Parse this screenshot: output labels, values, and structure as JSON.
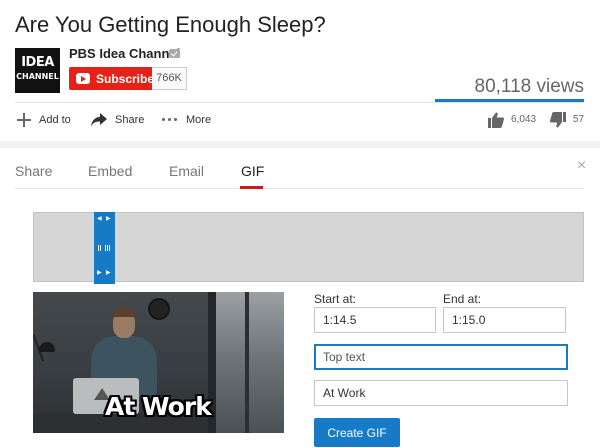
{
  "video": {
    "title": "Are You Getting Enough Sleep?",
    "views": "80,118 views"
  },
  "channel": {
    "logo_line1": "IDEA",
    "logo_line2": "CHANNEL",
    "name": "PBS Idea Channel",
    "subscribe_label": "Subscribe",
    "subscriber_count": "766K"
  },
  "actions": {
    "add_to": "Add to",
    "share": "Share",
    "more": "More",
    "likes": "6,043",
    "dislikes": "57"
  },
  "share_panel": {
    "tabs": [
      {
        "label": "Share"
      },
      {
        "label": "Embed"
      },
      {
        "label": "Email"
      },
      {
        "label": "GIF",
        "active": true
      }
    ],
    "close_symbol": "×"
  },
  "gif": {
    "caption": "At Work",
    "start_label": "Start at:",
    "start_value": "1:14.5",
    "end_label": "End at:",
    "end_value": "1:15.0",
    "top_text_placeholder": "Top text",
    "top_text_value": "",
    "bottom_text_value": "At Work",
    "create_label": "Create GIF"
  },
  "colors": {
    "accent": "#167ac6",
    "subscribe_red": "#e62117",
    "active_tab_underline": "#cc181e"
  },
  "icons": {
    "add": "plus-icon",
    "share": "share-arrow-icon",
    "more": "ellipsis-icon",
    "like": "thumbs-up-icon",
    "dislike": "thumbs-down-icon",
    "close": "close-icon",
    "verified": "verified-icon",
    "youtube": "youtube-play-icon"
  }
}
